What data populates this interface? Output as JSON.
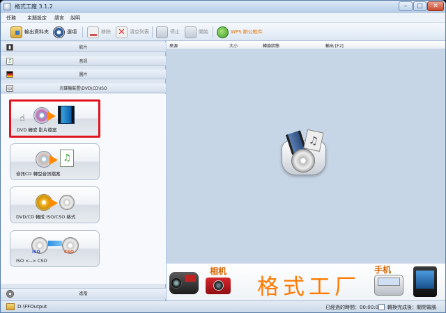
{
  "window": {
    "title": "格式工廠 3.1.2",
    "minimize": "–",
    "maximize": "□",
    "close": "✕"
  },
  "menu": [
    "任務",
    "主題設定",
    "語言",
    "說明"
  ],
  "toolbar": {
    "output_folder": "輸出資料夾",
    "options": "選項",
    "remove": "移除",
    "clear_list": "清空列表",
    "stop": "停止",
    "start": "開始",
    "wps": "WPS 辦公軟件"
  },
  "categories": [
    {
      "label": "影片",
      "icon": "film-icon"
    },
    {
      "label": "音訊",
      "icon": "music-note-icon"
    },
    {
      "label": "圖片",
      "icon": "image-flag-icon"
    },
    {
      "label": "光碟機裝置\\DVD\\CD\\ISO",
      "icon": "disc-drive-icon"
    }
  ],
  "tiles": [
    {
      "label": "DVD 轉成 影片檔案",
      "selected": true,
      "icon": "dvd-to-video-icon"
    },
    {
      "label": "音訊CD 轉型音訊檔案",
      "selected": false,
      "icon": "cd-to-audio-icon"
    },
    {
      "label": "DVD/CD 轉成 ISO/CSO 格式",
      "selected": false,
      "icon": "dvd-to-iso-icon"
    },
    {
      "label": "ISO <--> CSO",
      "selected": false,
      "icon": "iso-cso-convert-icon"
    }
  ],
  "advanced": {
    "label": "進階",
    "icon": "gear-icon"
  },
  "table": {
    "columns": [
      "來源",
      "大小",
      "轉換狀態",
      "輸出 [F2]"
    ]
  },
  "banner": {
    "title": "格式工厂",
    "camera_label": "相机",
    "phone_label": "手机"
  },
  "status": {
    "output_path": "D:\\FFOutput",
    "elapsed": "已經過的時間：00:00:00",
    "after_convert": "轉換完成後：關閉電腦"
  },
  "colors": {
    "brand_orange": "#ff7a00",
    "selection_red": "#e0141e",
    "list_bg": "#c7d6e6"
  }
}
